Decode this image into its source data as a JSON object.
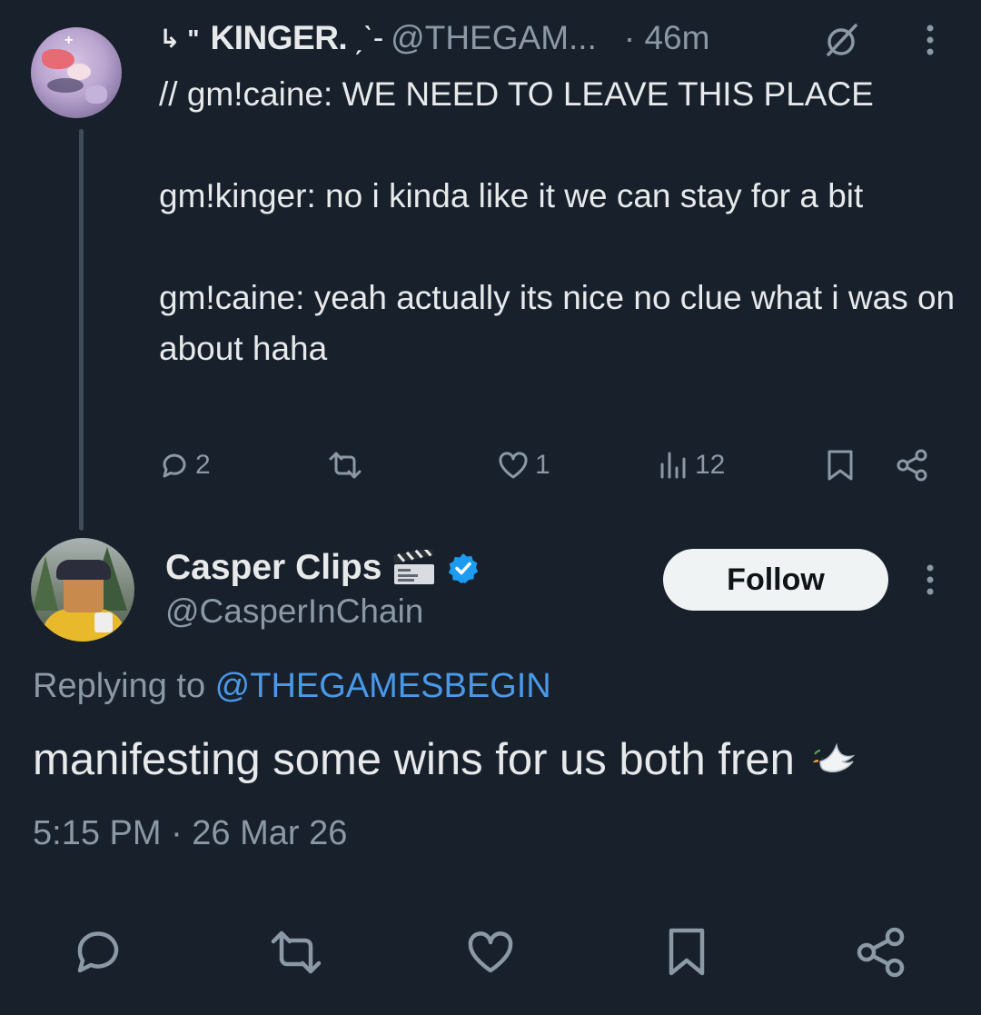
{
  "parent_tweet": {
    "reply_glyph": "↳ \"",
    "author_name": "KINGER.",
    "author_decoration": "ˏˋ-",
    "handle": "@THEGAM...",
    "time": "· 46m",
    "lines": [
      "// gm!caine: WE NEED TO LEAVE THIS PLACE",
      "gm!kinger: no i kinda like it we can stay for a bit",
      "gm!caine: yeah actually its nice no clue what i was on about haha"
    ],
    "replies_count": "2",
    "likes_count": "1",
    "views_count": "12",
    "icons": [
      "reply-icon",
      "retweet-icon",
      "like-icon",
      "views-icon",
      "bookmark-icon",
      "share-icon",
      "mute-icon",
      "more-icon"
    ]
  },
  "reply_tweet": {
    "author_name": "Casper Clips",
    "handle": "@CasperInChain",
    "follow_label": "Follow",
    "replying_prefix": "Replying to ",
    "replying_mention": "@THEGAMESBEGIN",
    "text": "manifesting some wins for us both fren",
    "timestamp": "5:15 PM · 26 Mar 26",
    "icons": [
      "clapperboard-icon",
      "verified-badge-icon",
      "dove-icon",
      "reply-icon",
      "retweet-icon",
      "like-icon",
      "bookmark-icon",
      "share-icon"
    ]
  },
  "colors": {
    "background": "#17202b",
    "text": "#e7e9ea",
    "muted": "#8b98a5",
    "link": "#4a99e9",
    "verified": "#1d9bf0",
    "follow_bg": "#eff3f4"
  }
}
